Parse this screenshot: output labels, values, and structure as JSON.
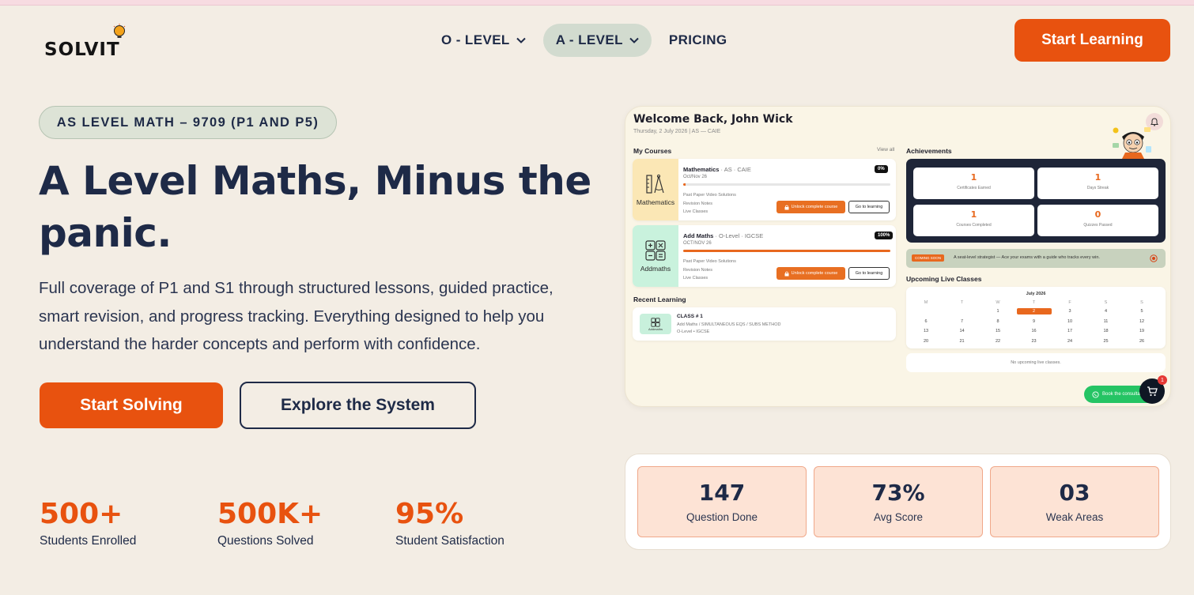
{
  "brand": {
    "logo_text": "SOLVIT"
  },
  "nav": {
    "items": [
      {
        "label": "O - LEVEL",
        "has_dropdown": true,
        "active": false
      },
      {
        "label": "A - LEVEL",
        "has_dropdown": true,
        "active": true
      },
      {
        "label": "PRICING",
        "has_dropdown": false,
        "active": false
      }
    ],
    "cta_label": "Start Learning"
  },
  "hero": {
    "chip": "AS LEVEL MATH – 9709 (P1 AND P5)",
    "title_line1": "A Level Maths, Minus the",
    "title_line2": "panic.",
    "desc_line1": "Full coverage of P1 and S1 through structured lessons, guided practice,",
    "desc_line2": "smart revision, and progress tracking. Everything designed to help you",
    "desc_line3": "understand the harder concepts and perform with confidence.",
    "primary_label": "Start Solving",
    "secondary_label": "Explore the System"
  },
  "stats": [
    {
      "value": "500+",
      "label": "Students Enrolled"
    },
    {
      "value": "500K+",
      "label": "Questions Solved"
    },
    {
      "value": "95%",
      "label": "Student Satisfaction"
    }
  ],
  "dashboard": {
    "welcome": "Welcome Back, John Wick",
    "subtitle": "Thursday, 2 July 2026 | AS — CAIE",
    "my_courses": "My Courses",
    "view_all": "View all",
    "achievements": "Achievements",
    "courses": [
      {
        "thumb_label": "Mathematics",
        "name": "Mathematics",
        "meta": " · AS · CAIE",
        "session": "Oct/Nov 26",
        "percent": "0%",
        "progress": 0.01,
        "list1": "Past Paper Video Solutions",
        "list2": "Revision Notes",
        "list3": "Live Classes",
        "unlock_label": "Unlock complete course",
        "go_label": "Go to learning"
      },
      {
        "thumb_label": "Addmaths",
        "name": "Add Maths",
        "meta": " · O-Level · IGCSE",
        "session": "OCT/NOV 26",
        "percent": "100%",
        "progress": 1.0,
        "list1": "Past Paper Video Solutions",
        "list2": "Revision Notes",
        "list3": "Live Classes",
        "unlock_label": "Unlock complete course",
        "go_label": "Go to learning"
      }
    ],
    "recent_heading": "Recent Learning",
    "recent": {
      "thumb_label": "Addmaths",
      "title": "CLASS # 1",
      "path": "Add Maths / SIMULTANEOUS EQS / SUBS METHOD",
      "level": "O-Level • IGCSE"
    },
    "ach_cards": [
      {
        "value": "1",
        "label": "Certificates Earned"
      },
      {
        "value": "1",
        "label": "Days Streak"
      },
      {
        "value": "1",
        "label": "Courses Completed"
      },
      {
        "value": "0",
        "label": "Quizzes Passed"
      }
    ],
    "banner_badge": "COMING SOON",
    "banner_text": "A seat-level strategist — Ace your exams with a guide who tracks every win.",
    "live_heading": "Upcoming Live Classes",
    "calendar_month": "July 2026",
    "calendar_headers": [
      "M",
      "T",
      "W",
      "T",
      "F",
      "S",
      "S"
    ],
    "calendar_weeks": [
      [
        "",
        "",
        "1",
        "2",
        "3",
        "4",
        "5"
      ],
      [
        "6",
        "7",
        "8",
        "9",
        "10",
        "11",
        "12"
      ],
      [
        "13",
        "14",
        "15",
        "16",
        "17",
        "18",
        "19"
      ],
      [
        "20",
        "21",
        "22",
        "23",
        "24",
        "25",
        "26"
      ]
    ],
    "today": "2",
    "no_upcoming": "No upcoming live classes.",
    "whatsapp_label": "Book the consultation",
    "cart_count": "1"
  },
  "summary": [
    {
      "value": "147",
      "label": "Question Done"
    },
    {
      "value": "73%",
      "label": "Avg Score"
    },
    {
      "value": "03",
      "label": "Weak Areas"
    }
  ],
  "colors": {
    "accent": "#e8520f",
    "navy": "#1e2a47",
    "background": "#f3ede4"
  }
}
